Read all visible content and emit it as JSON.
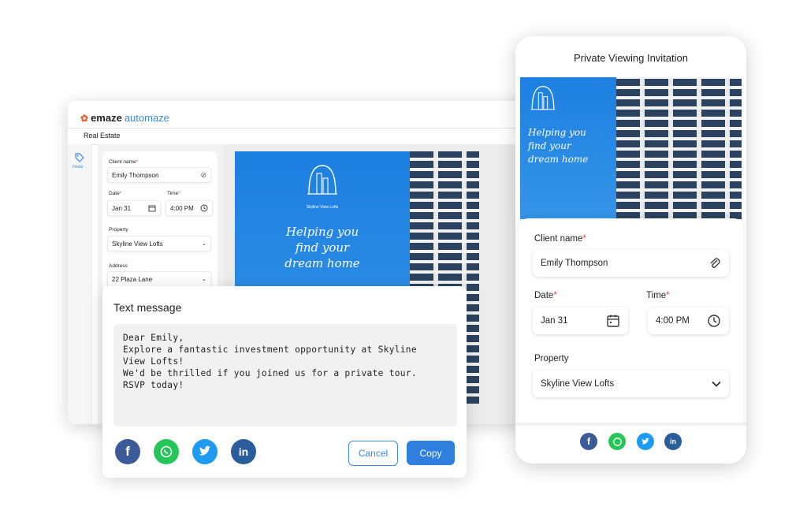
{
  "desktop": {
    "brand_prefix": "emaze",
    "brand_suffix": "automaze",
    "tab": "Real Estate",
    "rail_label": "Fields",
    "form": {
      "client_label": "Client name",
      "client_value": "Emily Thompson",
      "date_label": "Date",
      "date_value": "Jan 31",
      "time_label": "Time",
      "time_value": "4:00 PM",
      "property_label": "Property",
      "property_value": "Skyline View Lofts",
      "address_label": "Address",
      "address_value": "22 Plaza Lane"
    },
    "preview": {
      "logo_caption": "Skyline View Lofts",
      "tagline_1": "Helping you",
      "tagline_2": "find your",
      "tagline_3": "dream home"
    }
  },
  "message": {
    "title": "Text message",
    "line_1": "Dear Emily,",
    "line_2": "Explore a fantastic investment opportunity at Skyline",
    "line_3": "View Lofts!",
    "line_4": "We'd be thrilled if you joined us for a private tour.",
    "line_5": "RSVP today!",
    "cancel": "Cancel",
    "copy": "Copy",
    "social_icons": [
      "facebook-icon",
      "whatsapp-icon",
      "twitter-icon",
      "linkedin-icon"
    ]
  },
  "phone": {
    "title": "Private Viewing Invitation",
    "tagline_1": "Helping you",
    "tagline_2": "find your",
    "tagline_3": "dream home",
    "client_label": "Client name",
    "client_value": "Emily Thompson",
    "date_label": "Date",
    "date_value": "Jan 31",
    "time_label": "Time",
    "time_value": "4:00 PM",
    "property_label": "Property",
    "property_value": "Skyline View Lofts"
  },
  "colors": {
    "accent": "#3b8be0",
    "required": "#e24a4a",
    "facebook": "#3a5a98",
    "whatsapp": "#25c55a",
    "twitter": "#1d9bf0",
    "linkedin": "#2a5d9b"
  }
}
